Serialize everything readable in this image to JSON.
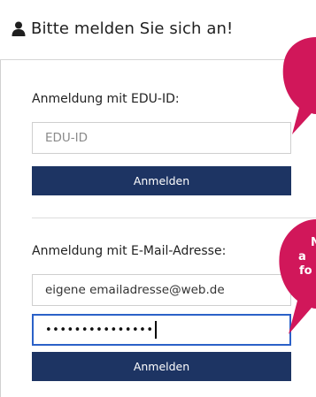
{
  "header": {
    "title": "Bitte melden Sie sich an!"
  },
  "edu_section": {
    "label": "Anmeldung mit EDU-ID:",
    "input_placeholder": "EDU-ID",
    "button_label": "Anmelden"
  },
  "email_section": {
    "label": "Anmeldung mit E-Mail-Adresse:",
    "email_value": "eigene emailadresse@web.de",
    "password_mask": "•••••••••••••••",
    "button_label": "Anmelden"
  },
  "callout": {
    "lines": [
      "N",
      "a",
      "fo"
    ]
  },
  "colors": {
    "button": "#1d3463",
    "callout": "#d1175a",
    "focus_border": "#2b61c8"
  },
  "icons": {
    "title_icon": "user-icon"
  }
}
